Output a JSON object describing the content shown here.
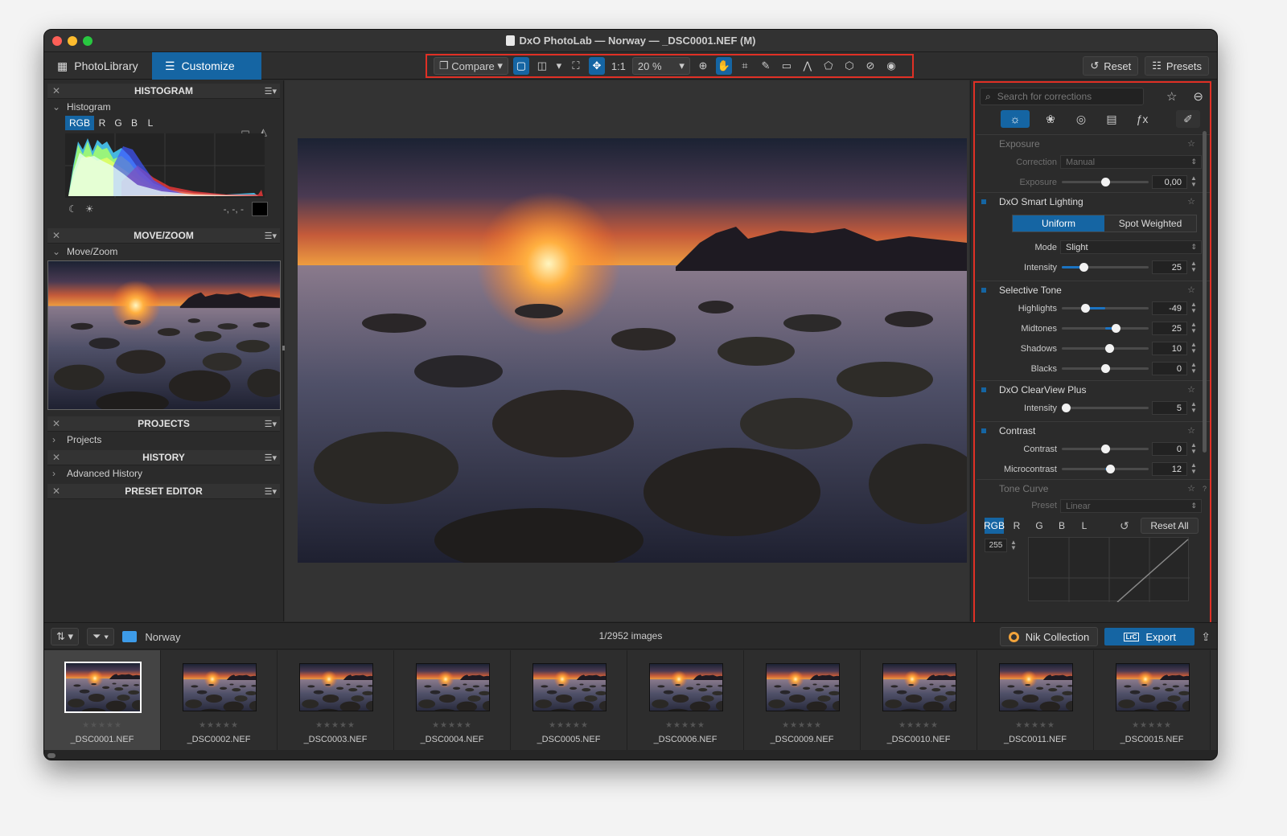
{
  "window": {
    "title": "DxO PhotoLab — Norway — _DSC0001.NEF (M)"
  },
  "toolbar": {
    "tab_library": "PhotoLibrary",
    "tab_customize": "Customize",
    "compare_label": "Compare",
    "one_to_one": "1:1",
    "zoom_value": "20 %",
    "reset_label": "Reset",
    "presets_label": "Presets"
  },
  "left": {
    "histogram": {
      "header": "HISTOGRAM",
      "sub": "Histogram",
      "channels": [
        "RGB",
        "R",
        "G",
        "B",
        "L"
      ],
      "value": "-, -, -"
    },
    "movezoom": {
      "header": "MOVE/ZOOM",
      "sub": "Move/Zoom"
    },
    "projects": {
      "header": "PROJECTS",
      "sub": "Projects"
    },
    "history": {
      "header": "HISTORY",
      "sub": "Advanced History"
    },
    "preset_editor": {
      "header": "PRESET EDITOR"
    }
  },
  "right": {
    "search_placeholder": "Search for corrections",
    "exposure": {
      "title": "Exposure",
      "correction_label": "Correction",
      "correction_value": "Manual",
      "exposure_label": "Exposure",
      "exposure_value": "0,00",
      "exposure_pos": 0.5
    },
    "smart_lighting": {
      "title": "DxO Smart Lighting",
      "mode_uniform": "Uniform",
      "mode_spot": "Spot Weighted",
      "mode_label": "Mode",
      "mode_value": "Slight",
      "intensity_label": "Intensity",
      "intensity_value": "25",
      "intensity_pos": 0.25
    },
    "selective_tone": {
      "title": "Selective Tone",
      "rows": [
        {
          "label": "Highlights",
          "value": "-49",
          "pos": 0.27
        },
        {
          "label": "Midtones",
          "value": "25",
          "pos": 0.62
        },
        {
          "label": "Shadows",
          "value": "10",
          "pos": 0.55
        },
        {
          "label": "Blacks",
          "value": "0",
          "pos": 0.5
        }
      ]
    },
    "clearview": {
      "title": "DxO ClearView Plus",
      "intensity_label": "Intensity",
      "intensity_value": "5",
      "intensity_pos": 0.05
    },
    "contrast": {
      "title": "Contrast",
      "contrast_label": "Contrast",
      "contrast_value": "0",
      "contrast_pos": 0.5,
      "micro_label": "Microcontrast",
      "micro_value": "12",
      "micro_pos": 0.56
    },
    "tone_curve": {
      "title": "Tone Curve",
      "preset_label": "Preset",
      "preset_value": "Linear",
      "channels": [
        "RGB",
        "R",
        "G",
        "B",
        "L"
      ],
      "reset_all": "Reset All",
      "level": "255"
    }
  },
  "bottom": {
    "folder": "Norway",
    "count": "1/2952 images",
    "nik": "Nik Collection",
    "export": "Export",
    "lrc": "LrC"
  },
  "filmstrip": [
    {
      "name": "_DSC0001.NEF"
    },
    {
      "name": "_DSC0002.NEF"
    },
    {
      "name": "_DSC0003.NEF"
    },
    {
      "name": "_DSC0004.NEF"
    },
    {
      "name": "_DSC0005.NEF"
    },
    {
      "name": "_DSC0006.NEF"
    },
    {
      "name": "_DSC0009.NEF"
    },
    {
      "name": "_DSC0010.NEF"
    },
    {
      "name": "_DSC0011.NEF"
    },
    {
      "name": "_DSC0015.NEF"
    }
  ],
  "colors": {
    "accent": "#1565a3",
    "highlight_frame": "#e03025"
  }
}
